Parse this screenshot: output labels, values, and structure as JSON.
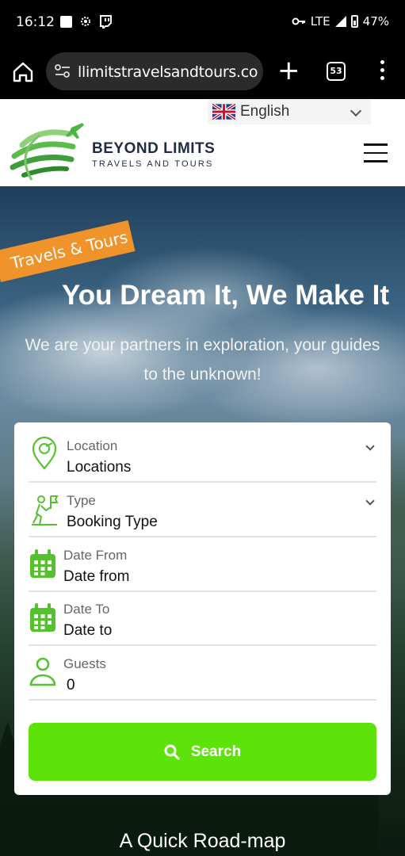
{
  "status_bar": {
    "time": "16:12",
    "network": "LTE",
    "battery": "47%",
    "icons": [
      "gallery-icon",
      "settings-gear-icon",
      "twitch-icon",
      "key-icon",
      "signal-icon",
      "battery-icon"
    ]
  },
  "browser": {
    "url": "llimitstravelsandtours.com",
    "tab_count": "53",
    "icons": [
      "home-icon",
      "site-settings-icon",
      "new-tab-plus-icon",
      "tab-switcher-icon",
      "overflow-menu-icon"
    ]
  },
  "header": {
    "language": "English",
    "brand_name": "BEYOND LIMITS",
    "brand_tagline": "TRAVELS AND TOURS",
    "icons": [
      "uk-flag-icon",
      "globe-plane-logo",
      "hamburger-menu-icon"
    ]
  },
  "hero": {
    "ribbon": "Travels & Tours",
    "title": "You Dream It, We Make It",
    "subtitle": "We are your partners in exploration, your guides to the unknown!"
  },
  "search_form": {
    "fields": [
      {
        "label": "Location",
        "value": "Locations",
        "icon": "location-pin-icon",
        "dropdown": true
      },
      {
        "label": "Type",
        "value": "Booking Type",
        "icon": "hiker-icon",
        "dropdown": true
      },
      {
        "label": "Date From",
        "value": "Date from",
        "icon": "calendar-icon",
        "dropdown": false
      },
      {
        "label": "Date To",
        "value": "Date to",
        "icon": "calendar-icon",
        "dropdown": false
      },
      {
        "label": "Guests",
        "value": "0",
        "icon": "user-icon",
        "dropdown": false
      }
    ],
    "button_label": "Search",
    "accent": "#5ee30a"
  },
  "section_heading": "A Quick Road-map",
  "colors": {
    "accent_green": "#5ee30a",
    "ribbon_orange": "#f0932b",
    "brand_navy": "#1f2a44"
  }
}
